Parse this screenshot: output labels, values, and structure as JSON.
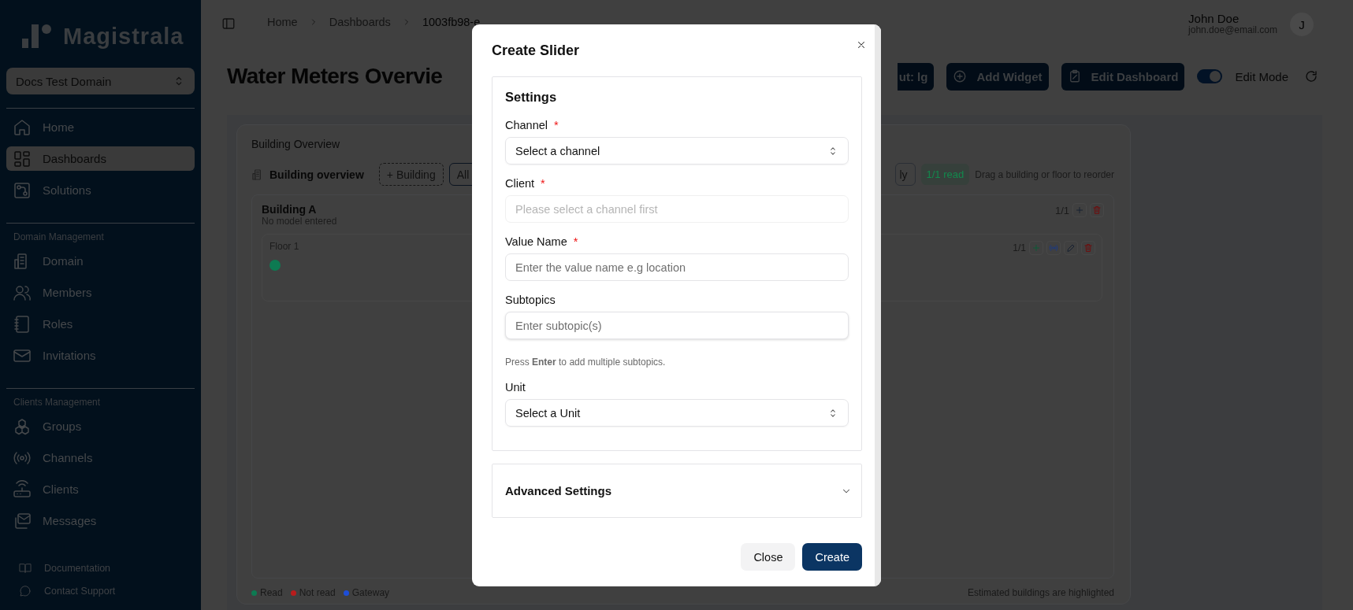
{
  "sidebar": {
    "logo": "Magistrala",
    "domain_select": "Docs Test Domain",
    "sections": [
      {
        "items": [
          {
            "label": "Home",
            "selected": false
          },
          {
            "label": "Dashboards",
            "selected": true
          },
          {
            "label": "Solutions",
            "selected": false
          }
        ]
      },
      {
        "heading": "Domain Management",
        "items": [
          {
            "label": "Domain",
            "selected": false
          },
          {
            "label": "Members",
            "selected": false
          },
          {
            "label": "Roles",
            "selected": false
          },
          {
            "label": "Invitations",
            "selected": false
          }
        ]
      },
      {
        "heading": "Clients Management",
        "items": [
          {
            "label": "Groups",
            "selected": false
          },
          {
            "label": "Channels",
            "selected": false
          },
          {
            "label": "Clients",
            "selected": false
          },
          {
            "label": "Messages",
            "selected": false
          }
        ]
      }
    ],
    "footer_links": [
      "Documentation",
      "Contact Support"
    ]
  },
  "breadcrumb": [
    "Home",
    "Dashboards",
    "1003fb98-e"
  ],
  "user": {
    "name": "John Doe",
    "email": "john.doe@email.com",
    "avatar": "J"
  },
  "page_title": "Water Meters Overvie",
  "toolbar": {
    "buttons": [
      "ut: lg",
      "Add Widget",
      "Edit Dashboard"
    ],
    "edit_mode": {
      "label": "Edit Mode",
      "on": true
    }
  },
  "widget": {
    "title": "Building Overview",
    "header": "Building overview",
    "add_button": "+ Building",
    "filters": [
      {
        "label": "All",
        "selected": true
      },
      {
        "label": "ly",
        "selected": false
      }
    ],
    "read_badge": "1/1 read",
    "hint": "Drag a building or floor to reorder",
    "buildings": [
      {
        "name": "Building A",
        "model": "No model entered",
        "count": "1/1",
        "floors": [
          {
            "name": "Floor 1",
            "count": "1/1",
            "meters": [
              {
                "color": "#0d7a52"
              }
            ]
          }
        ]
      }
    ],
    "legend": [
      {
        "label": "Read",
        "color": "#0d7a52"
      },
      {
        "label": "Not read",
        "color": "#b91c1c"
      },
      {
        "label": "Gateway",
        "color": "#1d4ed8"
      }
    ],
    "footnote": "Estimated buildings are highlighted"
  },
  "modal": {
    "title": "Create Slider",
    "settings": {
      "heading": "Settings",
      "fields": [
        {
          "kind": "select",
          "label": "Channel",
          "required_mark": "*",
          "value": "Select a channel",
          "disabled": false
        },
        {
          "kind": "input",
          "label": "Client",
          "required_mark": "*",
          "placeholder": "Please select a channel first",
          "disabled": true
        },
        {
          "kind": "input",
          "label": "Value Name",
          "required_mark": "*",
          "placeholder": "Enter the value name e.g location",
          "disabled": false
        },
        {
          "kind": "input",
          "label": "Subtopics",
          "placeholder": "Enter subtopic(s)",
          "disabled": false,
          "hint": "Press **Enter** to add multiple subtopics."
        },
        {
          "kind": "select",
          "label": "Unit",
          "value": "Select a Unit",
          "disabled": false
        }
      ]
    },
    "advanced": {
      "label": "Advanced Settings",
      "expanded": false
    },
    "buttons": {
      "close": "Close",
      "create": "Create"
    }
  }
}
